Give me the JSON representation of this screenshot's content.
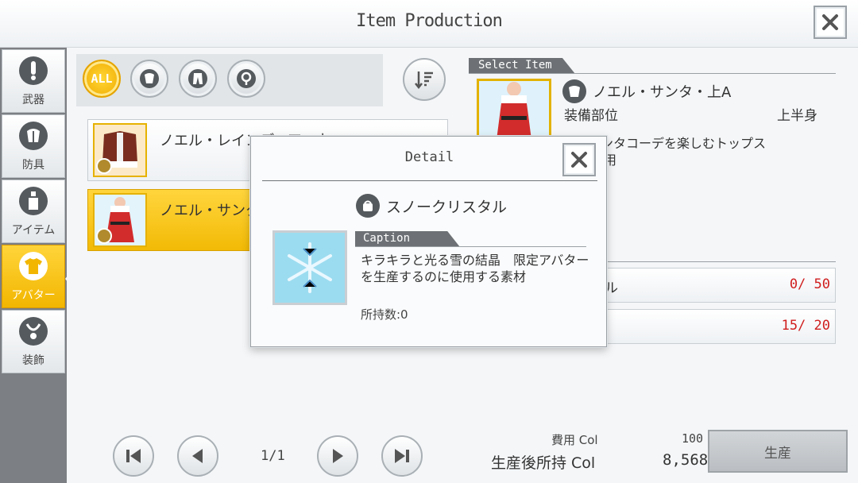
{
  "header": {
    "title": "Item Production"
  },
  "sidebar": {
    "tabs": [
      {
        "label": "武器",
        "icon": "sword-icon"
      },
      {
        "label": "防具",
        "icon": "armor-icon"
      },
      {
        "label": "アイテム",
        "icon": "potion-icon"
      },
      {
        "label": "アバター",
        "icon": "shirt-icon",
        "active": true
      },
      {
        "label": "装飾",
        "icon": "necklace-icon"
      }
    ]
  },
  "filters": {
    "all_label": "ALL",
    "buttons": [
      "all",
      "top-icon",
      "bottom-icon",
      "accessory-icon"
    ]
  },
  "list": {
    "items": [
      {
        "name": "ノエル・レインディア・上A",
        "selected": false
      },
      {
        "name": "ノエル・サンタ・上A",
        "selected": true
      }
    ]
  },
  "selected_item": {
    "section_label": "Select Item",
    "name": "ノエル・サンタ・上A",
    "equip_label": "装備部位",
    "equip_value": "上半身",
    "desc_line1": "サンタコーデを楽しむトップス",
    "desc_line2": "用"
  },
  "materials": [
    {
      "name": "ル",
      "count": "0/ 50"
    },
    {
      "name": "",
      "count": "15/ 20"
    }
  ],
  "pager": {
    "page": "1/1"
  },
  "footer": {
    "cost_label": "費用 Col",
    "cost_value": "100",
    "after_label": "生産後所持 Col",
    "after_value": "8,568",
    "produce_label": "生産"
  },
  "modal": {
    "title": "Detail",
    "item_name": "スノークリスタル",
    "caption_label": "Caption",
    "caption_text": "キラキラと光る雪の結晶　限定アバターを生産するのに使用する素材",
    "owned": "所持数:0"
  },
  "colors": {
    "accent": "#f2ba05",
    "count_red": "#d01e1e",
    "panel_dark": "#7c7f83"
  }
}
